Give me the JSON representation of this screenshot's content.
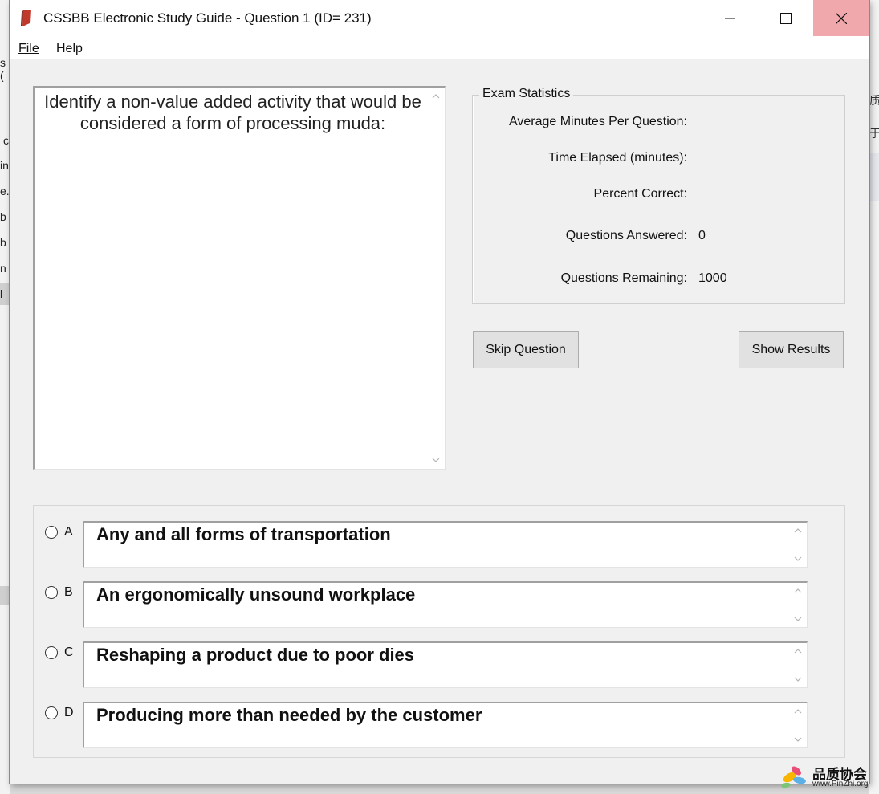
{
  "window": {
    "title": "CSSBB Electronic Study Guide - Question 1 (ID= 231)"
  },
  "menu": {
    "file": "File",
    "help": "Help"
  },
  "question": {
    "text": "Identify a non-value added activity that would be considered a form of processing muda:"
  },
  "stats": {
    "legend": "Exam Statistics",
    "avg_minutes_label": "Average Minutes Per Question:",
    "avg_minutes_value": "",
    "time_elapsed_label": "Time Elapsed (minutes):",
    "time_elapsed_value": "",
    "percent_correct_label": "Percent Correct:",
    "percent_correct_value": "",
    "answered_label": "Questions Answered:",
    "answered_value": "0",
    "remaining_label": "Questions Remaining:",
    "remaining_value": "1000"
  },
  "buttons": {
    "skip": "Skip Question",
    "results": "Show Results"
  },
  "options": [
    {
      "letter": "A",
      "text": "Any and all forms of transportation",
      "selected": false
    },
    {
      "letter": "B",
      "text": "An ergonomically unsound workplace",
      "selected": false
    },
    {
      "letter": "C",
      "text": "Reshaping a product due to poor dies",
      "selected": false
    },
    {
      "letter": "D",
      "text": "Producing more than needed by the customer",
      "selected": false
    }
  ],
  "watermark": {
    "name": "品质协会",
    "url": "www.PinZhi.org"
  },
  "background": {
    "left_fragments": [
      "s (",
      "c",
      "in",
      "e.i",
      "b",
      "b",
      "n",
      "l"
    ],
    "right_fragments": [
      "质",
      "于"
    ]
  },
  "colors": {
    "close_hover": "#f1a8ad",
    "window_bg": "#f0f0f0",
    "app_icon": "#c0392b"
  }
}
